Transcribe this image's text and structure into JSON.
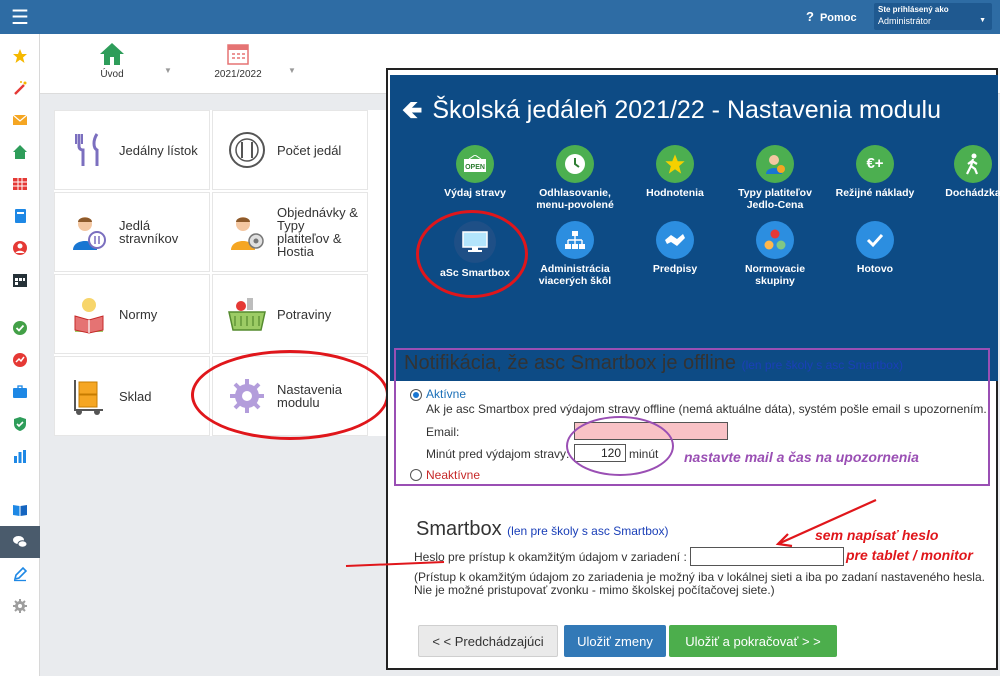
{
  "topbar": {
    "help_label": "Pomoc",
    "logged_as_label": "Ste prihlásený ako",
    "user_role": "Administrátor"
  },
  "toolbar": {
    "home_label": "Úvod",
    "year_label": "2021/2022"
  },
  "sidebar": {
    "icons": [
      "star-icon",
      "magic-wand-icon",
      "envelope-icon",
      "home-icon",
      "timetable-icon",
      "notebook-icon",
      "person-icon",
      "calendar-icon",
      "check-circle-icon",
      "chart-circle-icon",
      "briefcase-icon",
      "shield-icon",
      "bar-chart-icon",
      "book-icon",
      "chat-icon",
      "pen-icon",
      "gear-icon"
    ]
  },
  "modules": [
    {
      "label": "Jedálny lístok",
      "icon": "fork-knife-icon"
    },
    {
      "label": "Počet jedál",
      "icon": "plate-icon"
    },
    {
      "label": "Jedlá stravníkov",
      "icon": "diner-icon"
    },
    {
      "label_line1": "Objednávky & Typy",
      "label_line2": "platiteľov & Hostia",
      "icon": "orders-icon"
    },
    {
      "label": "Normy",
      "icon": "norms-icon"
    },
    {
      "label": "Potraviny",
      "icon": "basket-icon"
    },
    {
      "label": "Sklad",
      "icon": "warehouse-icon"
    },
    {
      "label": "Nastavenia modulu",
      "icon": "settings-gear-icon"
    }
  ],
  "dialog": {
    "title": "Školská jedáleň 2021/22 - Nastavenia modulu",
    "steps": [
      {
        "l1": "Výdaj stravy",
        "l2": "",
        "icon": "open-sign-icon",
        "color": "#4caf50"
      },
      {
        "l1": "Odhlasovanie,",
        "l2": "menu-povolené",
        "icon": "clock-icon",
        "color": "#4caf50"
      },
      {
        "l1": "Hodnotenia",
        "l2": "",
        "icon": "star-icon",
        "color": "#4caf50"
      },
      {
        "l1": "Typy platiteľov",
        "l2": "Jedlo-Cena",
        "icon": "payer-icon",
        "color": "#4caf50"
      },
      {
        "l1": "Režijné náklady",
        "l2": "",
        "icon": "euro-plus-icon",
        "color": "#4caf50"
      },
      {
        "l1": "Dochádzka",
        "l2": "",
        "icon": "walking-icon",
        "color": "#4caf50"
      },
      {
        "l1": "aSc Smartbox",
        "l2": "",
        "icon": "monitor-icon",
        "color": "#1e4f86"
      },
      {
        "l1": "Administrácia",
        "l2": "viacerých škôl",
        "icon": "network-icon",
        "color": "#2c8ee0"
      },
      {
        "l1": "Predpisy",
        "l2": "",
        "icon": "handshake-icon",
        "color": "#2c8ee0"
      },
      {
        "l1": "Normovacie",
        "l2": "skupiny",
        "icon": "groups-icon",
        "color": "#2c8ee0"
      },
      {
        "l1": "Hotovo",
        "l2": "",
        "icon": "check-icon",
        "color": "#2c8ee0"
      }
    ]
  },
  "notification": {
    "title": "Notifikácia, že asc Smartbox je offline",
    "title_note": "(len pre školy s asc Smartbox)",
    "active_label": "Aktívne",
    "description": "Ak je asc Smartbox pred výdajom stravy offline (nemá aktuálne dáta), systém pošle email s upozornením.",
    "email_label": "Email:",
    "minutes_label": "Minút pred výdajom stravy:",
    "minutes_value": "120",
    "minutes_unit": "minút",
    "inactive_label": "Neaktívne",
    "annotation": "nastavte mail a čas na upozornenia"
  },
  "smartbox": {
    "title": "Smartbox",
    "title_note": "(len pre školy s asc Smartbox)",
    "password_label": "Heslo pre prístup k okamžitým údajom v zariadení :",
    "note_line1": "(Prístup k okamžitým údajom zo zariadenia je možný iba v lokálnej sieti a iba po zadaní nastaveného hesla.",
    "note_line2": "Nie je možné pristupovať zvonku - mimo školskej počítačovej siete.)",
    "annotation_line1": "sem napísať heslo",
    "annotation_line2": "pre tablet / monitor"
  },
  "buttons": {
    "prev": "< < Predchádzajúci",
    "save": "Uložiť zmeny",
    "save_next": "Uložiť a pokračovať > >"
  },
  "colors": {
    "topbar": "#2e6ca4",
    "dialog_header": "#0d4b85",
    "annotation_red": "#e0161b",
    "annotation_purple": "#9a4fb4",
    "save_blue": "#3279b7",
    "next_green": "#4cae4c"
  }
}
